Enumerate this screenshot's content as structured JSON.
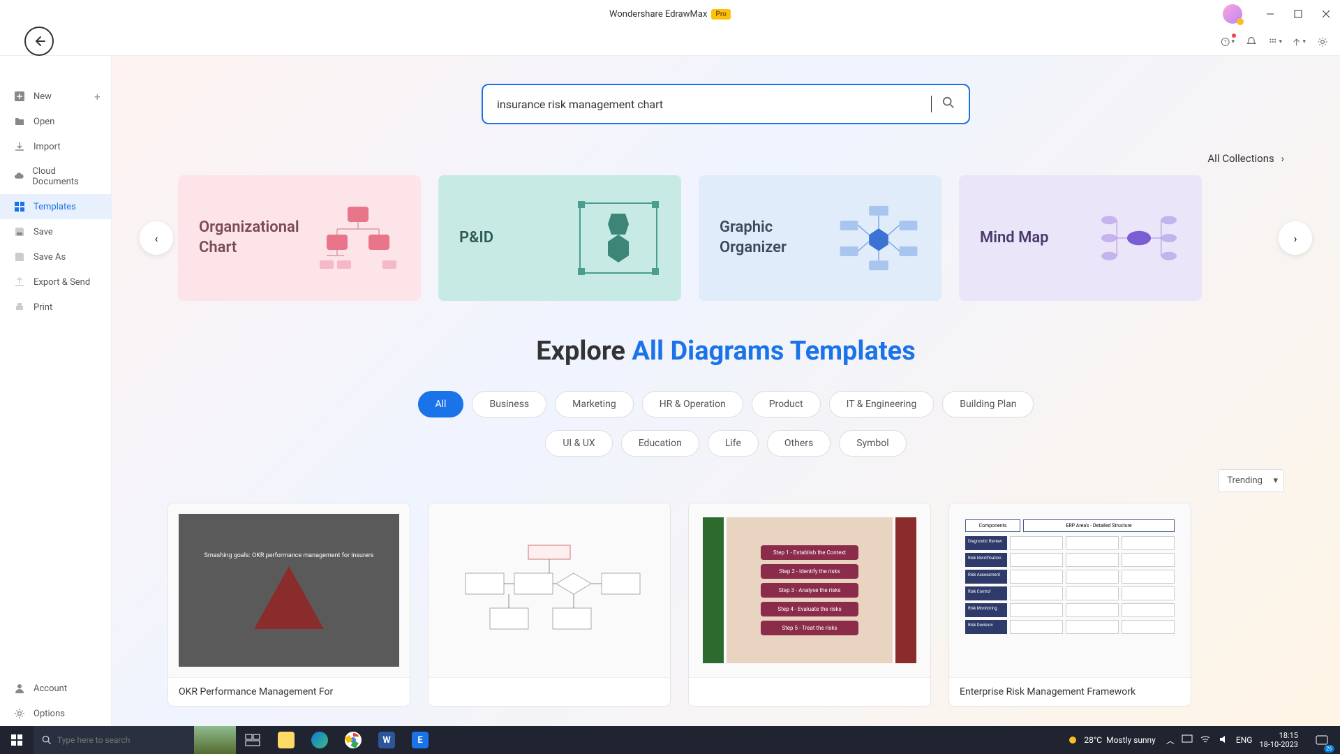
{
  "titlebar": {
    "app_name": "Wondershare EdrawMax",
    "badge": "Pro"
  },
  "sidebar": {
    "items": [
      {
        "label": "New",
        "icon": "plus-square"
      },
      {
        "label": "Open",
        "icon": "folder"
      },
      {
        "label": "Import",
        "icon": "download"
      },
      {
        "label": "Cloud Documents",
        "icon": "cloud"
      },
      {
        "label": "Templates",
        "icon": "grid"
      },
      {
        "label": "Save",
        "icon": "save"
      },
      {
        "label": "Save As",
        "icon": "save-as"
      },
      {
        "label": "Export & Send",
        "icon": "export"
      },
      {
        "label": "Print",
        "icon": "print"
      }
    ],
    "bottom": [
      {
        "label": "Account",
        "icon": "user"
      },
      {
        "label": "Options",
        "icon": "gear"
      }
    ]
  },
  "search": {
    "value": "insurance risk management chart"
  },
  "collections_link": "All Collections",
  "category_cards": [
    {
      "label": "Organizational\nChart",
      "color": "pink"
    },
    {
      "label": "P&ID",
      "color": "teal"
    },
    {
      "label": "Graphic\nOrganizer",
      "color": "blue"
    },
    {
      "label": "Mind Map",
      "color": "purple"
    }
  ],
  "explore": {
    "prefix": "Explore ",
    "highlight": "All Diagrams Templates"
  },
  "filters_row1": [
    "All",
    "Business",
    "Marketing",
    "HR & Operation",
    "Product",
    "IT & Engineering",
    "Building Plan"
  ],
  "filters_row2": [
    "UI & UX",
    "Education",
    "Life",
    "Others",
    "Symbol"
  ],
  "active_filter": "All",
  "sort": {
    "value": "Trending"
  },
  "templates": [
    {
      "title": "OKR Performance Management For",
      "thumb": "okr"
    },
    {
      "title": "",
      "thumb": "flow"
    },
    {
      "title": "",
      "thumb": "risk",
      "steps": [
        "Step 1 - Establish the Context",
        "Step 2 - Identify the risks",
        "Step 3 - Analyse the risks",
        "Step 4 - Evaluate the risks",
        "Step 5 - Treat the risks"
      ]
    },
    {
      "title": "Enterprise Risk Management Framework",
      "thumb": "erf"
    }
  ],
  "taskbar": {
    "search_placeholder": "Type here to search",
    "weather": {
      "temp": "28°C",
      "desc": "Mostly sunny"
    },
    "lang": "ENG",
    "time": "18:15",
    "date": "18-10-2023",
    "notif_count": "26"
  }
}
